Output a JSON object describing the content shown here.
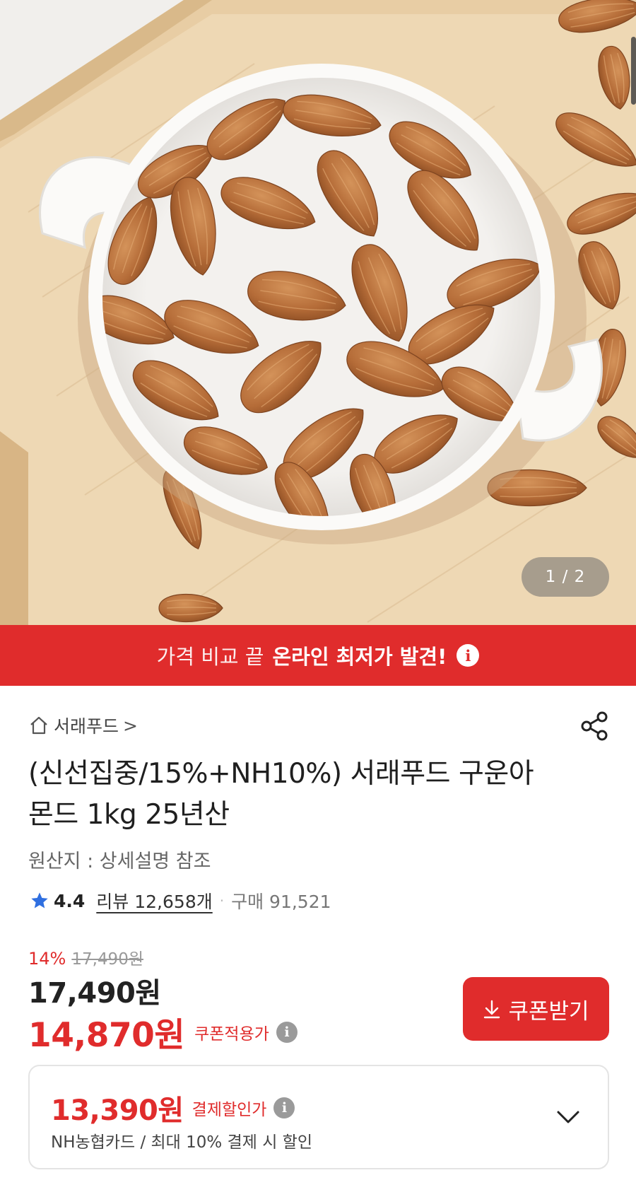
{
  "hero": {
    "image_alt": "almonds-in-white-bowl-photo",
    "counter": "1 / 2"
  },
  "banner": {
    "text_light": "가격 비교 끝",
    "text_bold": "온라인 최저가 발견!",
    "info_icon": "info-icon",
    "color": "#e02c2c"
  },
  "store": {
    "icon": "home-icon",
    "name": "서래푸드",
    "chevron": ">"
  },
  "share_icon": "share-icon",
  "product": {
    "title": "(신선집중/15%+NH10%) 서래푸드 구운아몬드 1kg 25년산",
    "origin": "원산지 : 상세설명 참조"
  },
  "rating": {
    "icon": "star-icon",
    "score": "4.4",
    "reviews": "리뷰 12,658개",
    "separator": "·",
    "purchases": "구매 91,521"
  },
  "price": {
    "discount_rate": "14%",
    "original_price": "17,490원",
    "sale_price": "17,490원",
    "coupon_price": "14,870원",
    "coupon_label": "쿠폰적용가",
    "coupon_button": "쿠폰받기",
    "coupon_button_icon": "download-icon"
  },
  "card_discount": {
    "price": "13,390원",
    "label": "결제할인가",
    "description": "NH농협카드 / 최대 10% 결제 시 할인",
    "chevron_icon": "chevron-down-icon"
  },
  "colors": {
    "accent": "#e02c2c",
    "tray": "#e9d3b0",
    "almond": "#b9723f"
  }
}
